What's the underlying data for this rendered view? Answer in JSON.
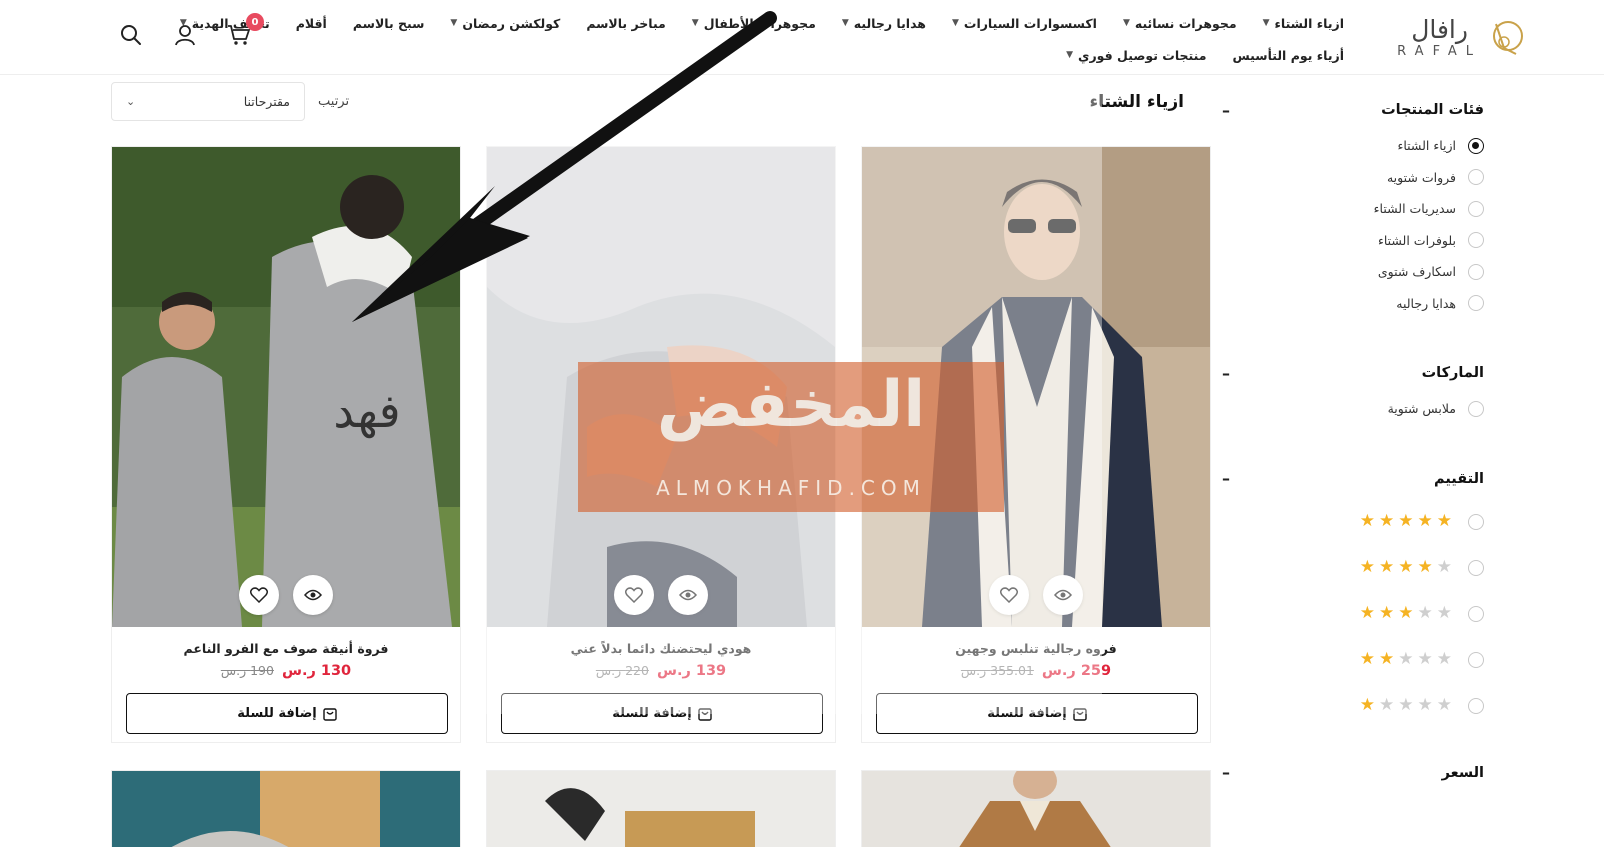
{
  "brand": {
    "name_ar": "رافال",
    "name_en": "RAFAL"
  },
  "nav": {
    "row1": [
      {
        "label": "ازياء الشتاء",
        "dropdown": true
      },
      {
        "label": "مجوهرات نسائيه",
        "dropdown": true
      },
      {
        "label": "اكسسوارات السيارات",
        "dropdown": true
      },
      {
        "label": "هدايا رجاليه",
        "dropdown": true
      },
      {
        "label": "مجوهرات الأطفال",
        "dropdown": true
      },
      {
        "label": "مباخر بالاسم",
        "dropdown": false
      },
      {
        "label": "كولكشن رمضان",
        "dropdown": true
      },
      {
        "label": "سبح بالاسم",
        "dropdown": false
      },
      {
        "label": "أقلام",
        "dropdown": false
      },
      {
        "label": "تغليف الهدية",
        "dropdown": true
      }
    ],
    "row2": [
      {
        "label": "أزياء يوم التأسيس",
        "dropdown": false
      },
      {
        "label": "منتجات توصيل فوري",
        "dropdown": true
      }
    ]
  },
  "header_icons": {
    "cart_count": "0",
    "icons": [
      "search-icon",
      "user-icon",
      "cart-icon"
    ]
  },
  "sidebar": {
    "categories": {
      "title": "فئات المنتجات",
      "toggle": "–",
      "items": [
        {
          "label": "ازياء الشتاء",
          "selected": true
        },
        {
          "label": "فروات شتويه",
          "selected": false
        },
        {
          "label": "سديريات الشتاء",
          "selected": false
        },
        {
          "label": "بلوفرات الشتاء",
          "selected": false
        },
        {
          "label": "اسكارف شتوى",
          "selected": false
        },
        {
          "label": "هدايا رجاليه",
          "selected": false
        }
      ]
    },
    "brands": {
      "title": "الماركات",
      "toggle": "–",
      "items": [
        {
          "label": "ملابس شتوية",
          "selected": false
        }
      ]
    },
    "rating": {
      "title": "التقييم",
      "toggle": "–",
      "levels": [
        5,
        4,
        3,
        2,
        1
      ]
    },
    "price": {
      "title": "السعر",
      "toggle": "–"
    }
  },
  "listing": {
    "category_title": "ازياء الشتاء",
    "sort_label": "ترتيب",
    "sort_value": "مقترحاتنا"
  },
  "products": [
    {
      "name": "فروه رجالية تنلبس وجهين",
      "price": "259 ر.س",
      "old_price": "355.01 ر.س",
      "add_label": "إضافة للسلة"
    },
    {
      "name": "هودي ليحتضنك دائما بدلاً عني",
      "price": "139 ر.س",
      "old_price": "220 ر.س",
      "add_label": "إضافة للسلة"
    },
    {
      "name": "فروة أنيقة صوف مع الفرو الناعم",
      "price": "130 ر.س",
      "old_price": "190 ر.س",
      "add_label": "إضافة للسلة"
    }
  ],
  "watermark": {
    "text_ar": "المخفض",
    "text_en": "ALMOKHAFID.COM"
  },
  "colors": {
    "accent_price": "#e0253c",
    "badge": "#e84a5f",
    "star": "#f5b323",
    "logo_gold": "#c9a24a"
  }
}
